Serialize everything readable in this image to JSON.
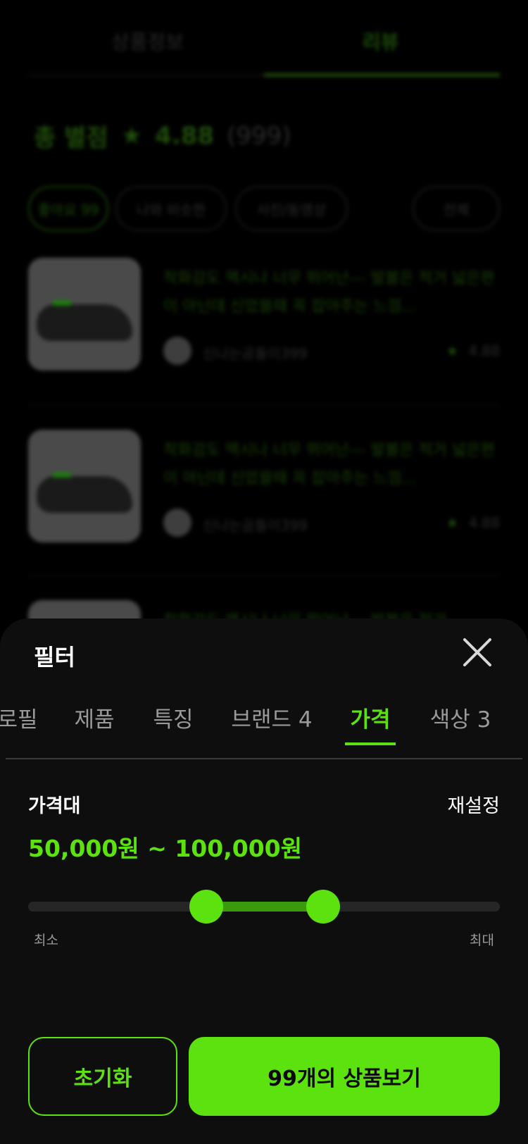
{
  "background": {
    "tabs": [
      "상품정보",
      "리뷰"
    ],
    "score": {
      "label": "총 별점",
      "star": "★",
      "value": "4.88",
      "count": "(999)"
    },
    "chips": [
      "좋아요 99",
      "나와 비슷한",
      "사진/동영상",
      "전체"
    ],
    "reviews": [
      {
        "text": "착화감도 맥시나 너무 뛰어난--- 발볼은 적거 넓은편이 아닌데 신었을때 꼭 잡아주는 느낌...",
        "user": "신나는곰돌이399",
        "rating": "4.88"
      },
      {
        "text": "착화감도 맥시나 너무 뛰어난--- 발볼은 적거 넓은편이 아닌데 신었을때 꼭 잡아주는 느낌...",
        "user": "신나는곰돌이399",
        "rating": "4.88"
      },
      {
        "text": "착화감도 맥시나 너무 뛰어난--- 발볼은 적거",
        "user": "",
        "rating": ""
      }
    ]
  },
  "sheet": {
    "title": "필터",
    "tabs": [
      {
        "label": "로필"
      },
      {
        "label": "제품"
      },
      {
        "label": "특징"
      },
      {
        "label": "브랜드 4"
      },
      {
        "label": "가격"
      },
      {
        "label": "색상 3"
      }
    ],
    "active_tab": "가격",
    "price": {
      "label": "가격대",
      "reset": "재설정",
      "value": "50,000원 ~ 100,000원",
      "range_fraction": [
        0.378,
        0.626
      ],
      "min_label": "최소",
      "max_label": "최대"
    },
    "buttons": {
      "reset": "초기화",
      "apply": "99개의 상품보기"
    }
  },
  "colors": {
    "accent": "#5ce20e",
    "sheet_bg": "#0e0e0e",
    "page_bg": "#000000"
  }
}
